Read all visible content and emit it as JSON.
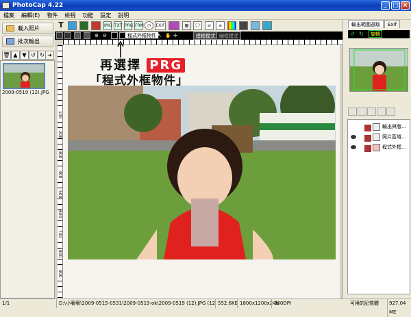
{
  "window": {
    "title": "PhotoCap 4.22"
  },
  "menu": [
    "檔案",
    "編輯(E)",
    "物件",
    "檢視",
    "功能",
    "設定",
    "說明"
  ],
  "left": {
    "load_label": "載入照片",
    "batch_label": "批次輸出",
    "thumb_caption": "2009-0519 (12).JPG",
    "page_count": "1/1"
  },
  "toolbar": {
    "tooltip": "程式外框物件",
    "mode1": "模框模式",
    "mode2": "圖框模式",
    "exif_label": "EXIF"
  },
  "annotation": {
    "line1": "再選擇",
    "badge": "PRG",
    "line2": "「程式外框物件」"
  },
  "ruler": {
    "left_numbers": [
      "100",
      "200",
      "300",
      "400",
      "500",
      "600",
      "700",
      "800",
      "900"
    ]
  },
  "status": {
    "path": "D:\\小奢奢\\2009-0515-0531\\2009-0519-ok\\2009-0519 (12).JPG (1280×960×24)",
    "size": "552.6KB",
    "dims": "1800x1200x24b",
    "dpi": "300DPI"
  },
  "right": {
    "tab1": "輸出範圍選取",
    "tab2": "Exif",
    "rotate_label": "旋轉",
    "layers": [
      {
        "label": "輸出與版..."
      },
      {
        "label": "照片區域..."
      },
      {
        "label": "程式外框..."
      }
    ],
    "memory_label": "可用的記憶體",
    "memory_value": "927.04 ME"
  }
}
